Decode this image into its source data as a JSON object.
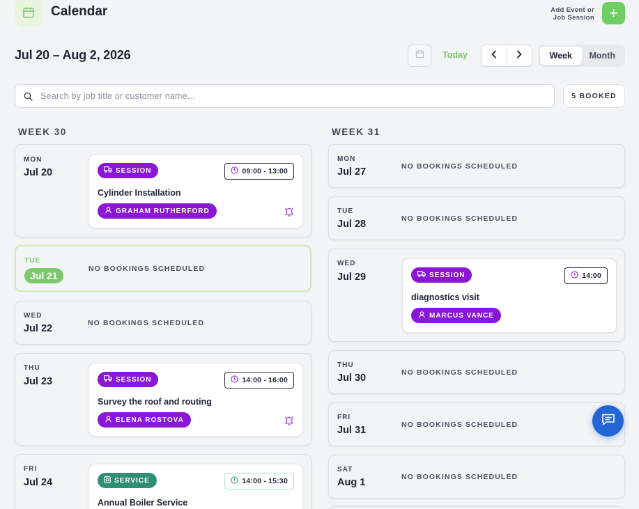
{
  "header": {
    "title": "Calendar",
    "add_label_line1": "Add Event or",
    "add_label_line2": "Job Session",
    "add_button": "+"
  },
  "toolbar": {
    "date_range": "Jul 20 – Aug 2, 2026",
    "today_label": "Today",
    "view_week": "Week",
    "view_month": "Month",
    "active_view": "Week"
  },
  "search": {
    "placeholder": "Search by job title or customer name...",
    "value": ""
  },
  "booked_count": "5 BOOKED",
  "colors": {
    "accent_green": "#79c86a",
    "session_purple": "#8a16d6",
    "service_teal": "#2e8f73",
    "chat_blue": "#2466d6"
  },
  "weeks": [
    {
      "title": "WEEK 30",
      "days": [
        {
          "dow": "MON",
          "date": "Jul 20",
          "events": [
            {
              "type": "SESSION",
              "time": "09:00 - 13:00",
              "title": "Cylinder Installation",
              "assignee": "GRAHAM RUTHERFORD",
              "reminder": true
            }
          ]
        },
        {
          "dow": "TUE",
          "date": "Jul 21",
          "today": true,
          "empty_text": "NO BOOKINGS SCHEDULED"
        },
        {
          "dow": "WED",
          "date": "Jul 22",
          "empty_text": "NO BOOKINGS SCHEDULED"
        },
        {
          "dow": "THU",
          "date": "Jul 23",
          "events": [
            {
              "type": "SESSION",
              "time": "14:00 - 16:00",
              "title": "Survey the roof and routing",
              "assignee": "ELENA ROSTOVA",
              "reminder": true
            }
          ]
        },
        {
          "dow": "FRI",
          "date": "Jul 24",
          "events": [
            {
              "type": "SERVICE",
              "time": "14:00 - 15:30",
              "title": "Annual Boiler Service"
            }
          ]
        }
      ]
    },
    {
      "title": "WEEK 31",
      "days": [
        {
          "dow": "MON",
          "date": "Jul 27",
          "empty_text": "NO BOOKINGS SCHEDULED"
        },
        {
          "dow": "TUE",
          "date": "Jul 28",
          "empty_text": "NO BOOKINGS SCHEDULED"
        },
        {
          "dow": "WED",
          "date": "Jul 29",
          "events": [
            {
              "type": "SESSION",
              "time": "14:00",
              "title": "diagnostics visit",
              "assignee": "MARCUS VANCE"
            }
          ]
        },
        {
          "dow": "THU",
          "date": "Jul 30",
          "empty_text": "NO BOOKINGS SCHEDULED"
        },
        {
          "dow": "FRI",
          "date": "Jul 31",
          "empty_text": "NO BOOKINGS SCHEDULED"
        },
        {
          "dow": "SAT",
          "date": "Aug 1",
          "empty_text": "NO BOOKINGS SCHEDULED"
        }
      ]
    }
  ],
  "icons": {
    "logo": "calendar-icon",
    "picker": "calendar-icon",
    "prev": "chevron-left-icon",
    "next": "chevron-right-icon",
    "search": "search-icon",
    "session": "truck-icon",
    "service": "wrench-icon",
    "time": "clock-icon",
    "person": "user-icon",
    "reminder": "bell-icon",
    "chat": "chat-icon"
  }
}
